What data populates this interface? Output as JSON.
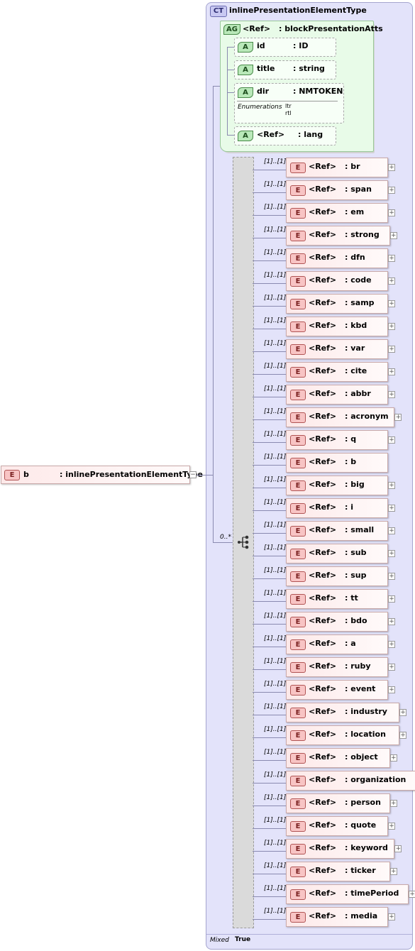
{
  "complex_type": {
    "badge": "CT",
    "name": "inlinePresentationElementType"
  },
  "root_element": {
    "badge": "E",
    "name": "b",
    "type": ": inlinePresentationElementType"
  },
  "attribute_group": {
    "badge": "AG",
    "ref": "<Ref>",
    "name": ": blockPresentationAtts",
    "attributes": [
      {
        "badge": "A",
        "name": "id",
        "type": ": ID"
      },
      {
        "badge": "A",
        "name": "title",
        "type": ": string"
      },
      {
        "badge": "A",
        "name": "dir",
        "type": ": NMTOKEN",
        "enum_label": "Enumerations",
        "enum_values": [
          "ltr",
          "rtl"
        ]
      },
      {
        "badge": "A",
        "name": "<Ref>",
        "type": ": lang"
      }
    ]
  },
  "choice": {
    "occurrence": "0..*"
  },
  "children": [
    {
      "badge": "E",
      "ref": "<Ref>",
      "name": ": br",
      "occurrence": "[1]..[1]",
      "expandable": true
    },
    {
      "badge": "E",
      "ref": "<Ref>",
      "name": ": span",
      "occurrence": "[1]..[1]",
      "expandable": true
    },
    {
      "badge": "E",
      "ref": "<Ref>",
      "name": ": em",
      "occurrence": "[1]..[1]",
      "expandable": true
    },
    {
      "badge": "E",
      "ref": "<Ref>",
      "name": ": strong",
      "occurrence": "[1]..[1]",
      "expandable": true
    },
    {
      "badge": "E",
      "ref": "<Ref>",
      "name": ": dfn",
      "occurrence": "[1]..[1]",
      "expandable": true
    },
    {
      "badge": "E",
      "ref": "<Ref>",
      "name": ": code",
      "occurrence": "[1]..[1]",
      "expandable": true
    },
    {
      "badge": "E",
      "ref": "<Ref>",
      "name": ": samp",
      "occurrence": "[1]..[1]",
      "expandable": true
    },
    {
      "badge": "E",
      "ref": "<Ref>",
      "name": ": kbd",
      "occurrence": "[1]..[1]",
      "expandable": true
    },
    {
      "badge": "E",
      "ref": "<Ref>",
      "name": ": var",
      "occurrence": "[1]..[1]",
      "expandable": true
    },
    {
      "badge": "E",
      "ref": "<Ref>",
      "name": ": cite",
      "occurrence": "[1]..[1]",
      "expandable": true
    },
    {
      "badge": "E",
      "ref": "<Ref>",
      "name": ": abbr",
      "occurrence": "[1]..[1]",
      "expandable": true
    },
    {
      "badge": "E",
      "ref": "<Ref>",
      "name": ": acronym",
      "occurrence": "[1]..[1]",
      "expandable": true
    },
    {
      "badge": "E",
      "ref": "<Ref>",
      "name": ": q",
      "occurrence": "[1]..[1]",
      "expandable": true
    },
    {
      "badge": "E",
      "ref": "<Ref>",
      "name": ": b",
      "occurrence": "[1]..[1]",
      "expandable": false
    },
    {
      "badge": "E",
      "ref": "<Ref>",
      "name": ": big",
      "occurrence": "[1]..[1]",
      "expandable": true
    },
    {
      "badge": "E",
      "ref": "<Ref>",
      "name": ": i",
      "occurrence": "[1]..[1]",
      "expandable": true
    },
    {
      "badge": "E",
      "ref": "<Ref>",
      "name": ": small",
      "occurrence": "[1]..[1]",
      "expandable": true
    },
    {
      "badge": "E",
      "ref": "<Ref>",
      "name": ": sub",
      "occurrence": "[1]..[1]",
      "expandable": true
    },
    {
      "badge": "E",
      "ref": "<Ref>",
      "name": ": sup",
      "occurrence": "[1]..[1]",
      "expandable": true
    },
    {
      "badge": "E",
      "ref": "<Ref>",
      "name": ": tt",
      "occurrence": "[1]..[1]",
      "expandable": true
    },
    {
      "badge": "E",
      "ref": "<Ref>",
      "name": ": bdo",
      "occurrence": "[1]..[1]",
      "expandable": true
    },
    {
      "badge": "E",
      "ref": "<Ref>",
      "name": ": a",
      "occurrence": "[1]..[1]",
      "expandable": true
    },
    {
      "badge": "E",
      "ref": "<Ref>",
      "name": ": ruby",
      "occurrence": "[1]..[1]",
      "expandable": true
    },
    {
      "badge": "E",
      "ref": "<Ref>",
      "name": ": event",
      "occurrence": "[1]..[1]",
      "expandable": true
    },
    {
      "badge": "E",
      "ref": "<Ref>",
      "name": ": industry",
      "occurrence": "[1]..[1]",
      "expandable": true
    },
    {
      "badge": "E",
      "ref": "<Ref>",
      "name": ": location",
      "occurrence": "[1]..[1]",
      "expandable": true
    },
    {
      "badge": "E",
      "ref": "<Ref>",
      "name": ": object",
      "occurrence": "[1]..[1]",
      "expandable": true
    },
    {
      "badge": "E",
      "ref": "<Ref>",
      "name": ": organization",
      "occurrence": "[1]..[1]",
      "expandable": true
    },
    {
      "badge": "E",
      "ref": "<Ref>",
      "name": ": person",
      "occurrence": "[1]..[1]",
      "expandable": true
    },
    {
      "badge": "E",
      "ref": "<Ref>",
      "name": ": quote",
      "occurrence": "[1]..[1]",
      "expandable": true
    },
    {
      "badge": "E",
      "ref": "<Ref>",
      "name": ": keyword",
      "occurrence": "[1]..[1]",
      "expandable": true
    },
    {
      "badge": "E",
      "ref": "<Ref>",
      "name": ": ticker",
      "occurrence": "[1]..[1]",
      "expandable": true
    },
    {
      "badge": "E",
      "ref": "<Ref>",
      "name": ": timePeriod",
      "occurrence": "[1]..[1]",
      "expandable": true
    },
    {
      "badge": "E",
      "ref": "<Ref>",
      "name": ": media",
      "occurrence": "[1]..[1]",
      "expandable": true
    }
  ],
  "footer": {
    "label": "Mixed",
    "value": "True"
  },
  "colors": {
    "ct_panel": "#e3e3fa",
    "attr_panel": "#e8fbe8",
    "element_fill": "#fde9e9",
    "connector": "#8a8ab0"
  },
  "icons": {
    "expand": "plus-icon",
    "collapse": "minus-icon",
    "choice": "choice-compositor-icon"
  }
}
